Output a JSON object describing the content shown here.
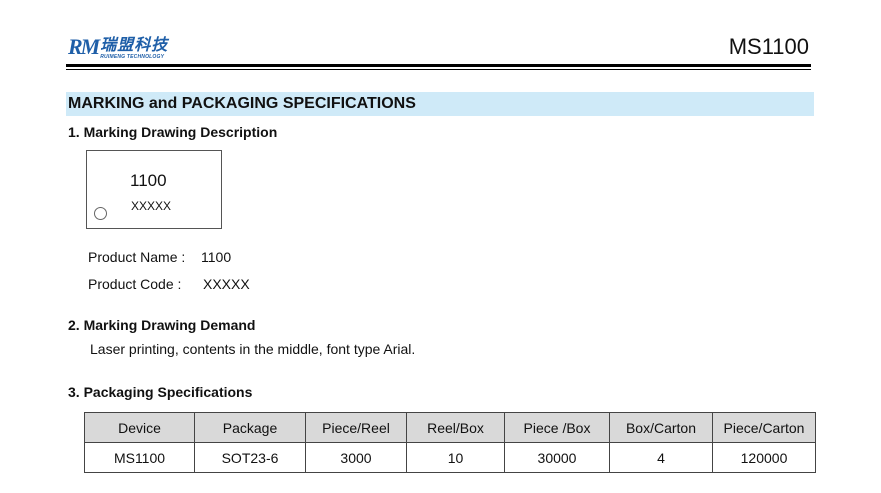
{
  "header": {
    "logo_mark": "RM",
    "logo_cn": "瑞盟科技",
    "logo_en": "RUIMENG TECHNOLOGY",
    "doc_title": "MS1100",
    "brand_color": "#1f5fa8"
  },
  "section": {
    "title": "MARKING and PACKAGING SPECIFICATIONS",
    "bar_color": "#cfeaf8"
  },
  "marking": {
    "heading": "1. Marking Drawing Description",
    "chip_code": "1100",
    "chip_sub": "XXXXX",
    "product_name_label": "Product Name :",
    "product_name_value": "1100",
    "product_code_label": "Product Code :",
    "product_code_value": "XXXXX"
  },
  "demand": {
    "heading": "2. Marking Drawing Demand",
    "text": "Laser printing, contents in the middle, font type Arial."
  },
  "packaging": {
    "heading": "3. Packaging Specifications",
    "columns": [
      "Device",
      "Package",
      "Piece/Reel",
      "Reel/Box",
      "Piece /Box",
      "Box/Carton",
      "Piece/Carton"
    ],
    "rows": [
      [
        "MS1100",
        "SOT23-6",
        "3000",
        "10",
        "30000",
        "4",
        "120000"
      ]
    ]
  }
}
